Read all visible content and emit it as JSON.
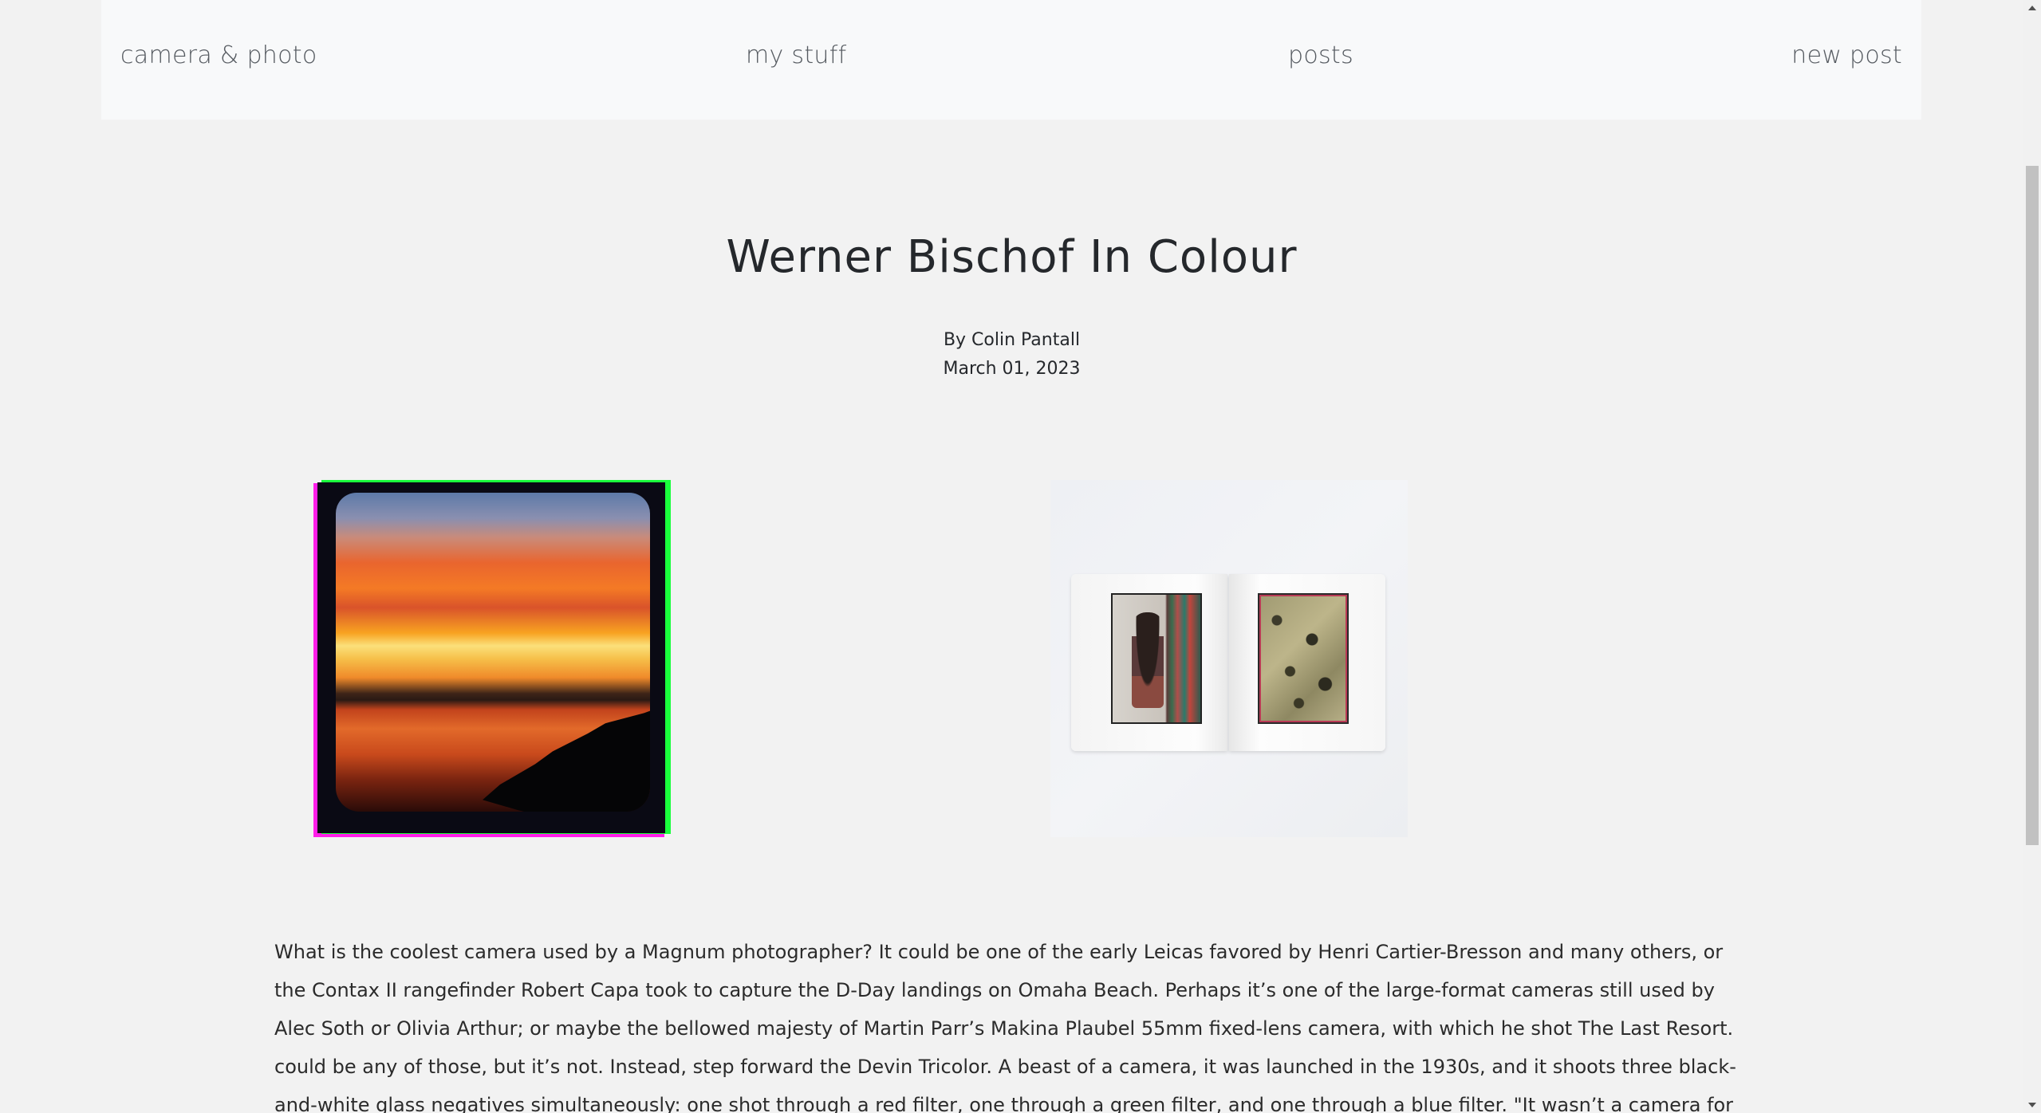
{
  "nav": {
    "brand": "camera & photo",
    "my_stuff": "my stuff",
    "posts": "posts",
    "new_post": "new post"
  },
  "article": {
    "title": "Werner Bischof In Colour",
    "byline": "By Colin Pantall",
    "date": "March 01, 2023",
    "body": "What is the coolest camera used by a Magnum photographer? It could be one of the early Leicas favored by Henri Cartier-Bresson and many others, or the Contax II rangefinder Robert Capa took to capture the D-Day landings on Omaha Beach. Perhaps it’s one of the large-format cameras still used by Alec Soth or Olivia Arthur; or maybe the bellowed majesty of Martin Parr’s Makina Plaubel 55mm fixed-lens camera, with which he shot The Last Resort. could be any of those, but it’s not. Instead, step forward the Devin Tricolor. A beast of a camera, it was launched in the 1930s, and it shoots three black-and-white glass negatives simultaneously: one shot through a red filter, one through a green filter, and one through a blue filter. \"It wasn’t a camera for street photography. You had to think"
  },
  "images": {
    "first": "sunset-photo",
    "second": "open-book-photo"
  }
}
